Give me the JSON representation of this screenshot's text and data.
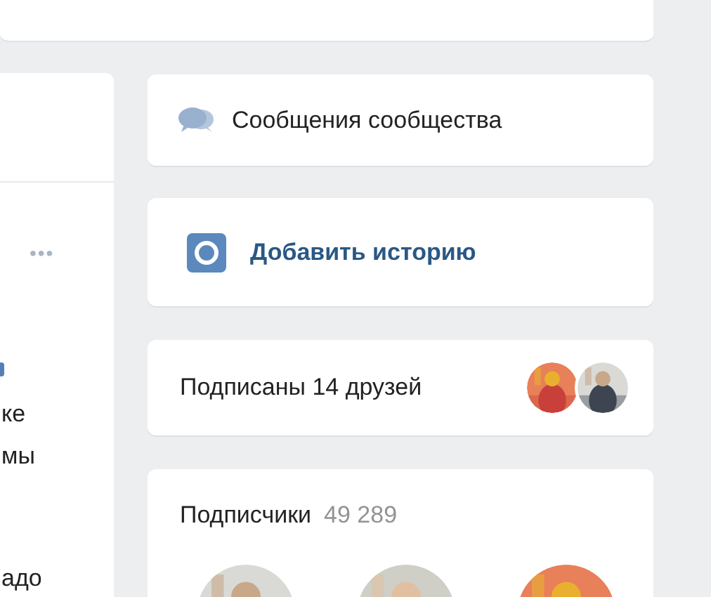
{
  "post_fragment": {
    "more": "•••",
    "lines": [
      "ке",
      "мы",
      "адо"
    ]
  },
  "community_messages": {
    "label": "Сообщения сообщества"
  },
  "add_story": {
    "label": "Добавить историю"
  },
  "friends_following": {
    "label": "Подписаны 14 друзей"
  },
  "followers": {
    "title": "Подписчики",
    "count": "49 289"
  }
}
